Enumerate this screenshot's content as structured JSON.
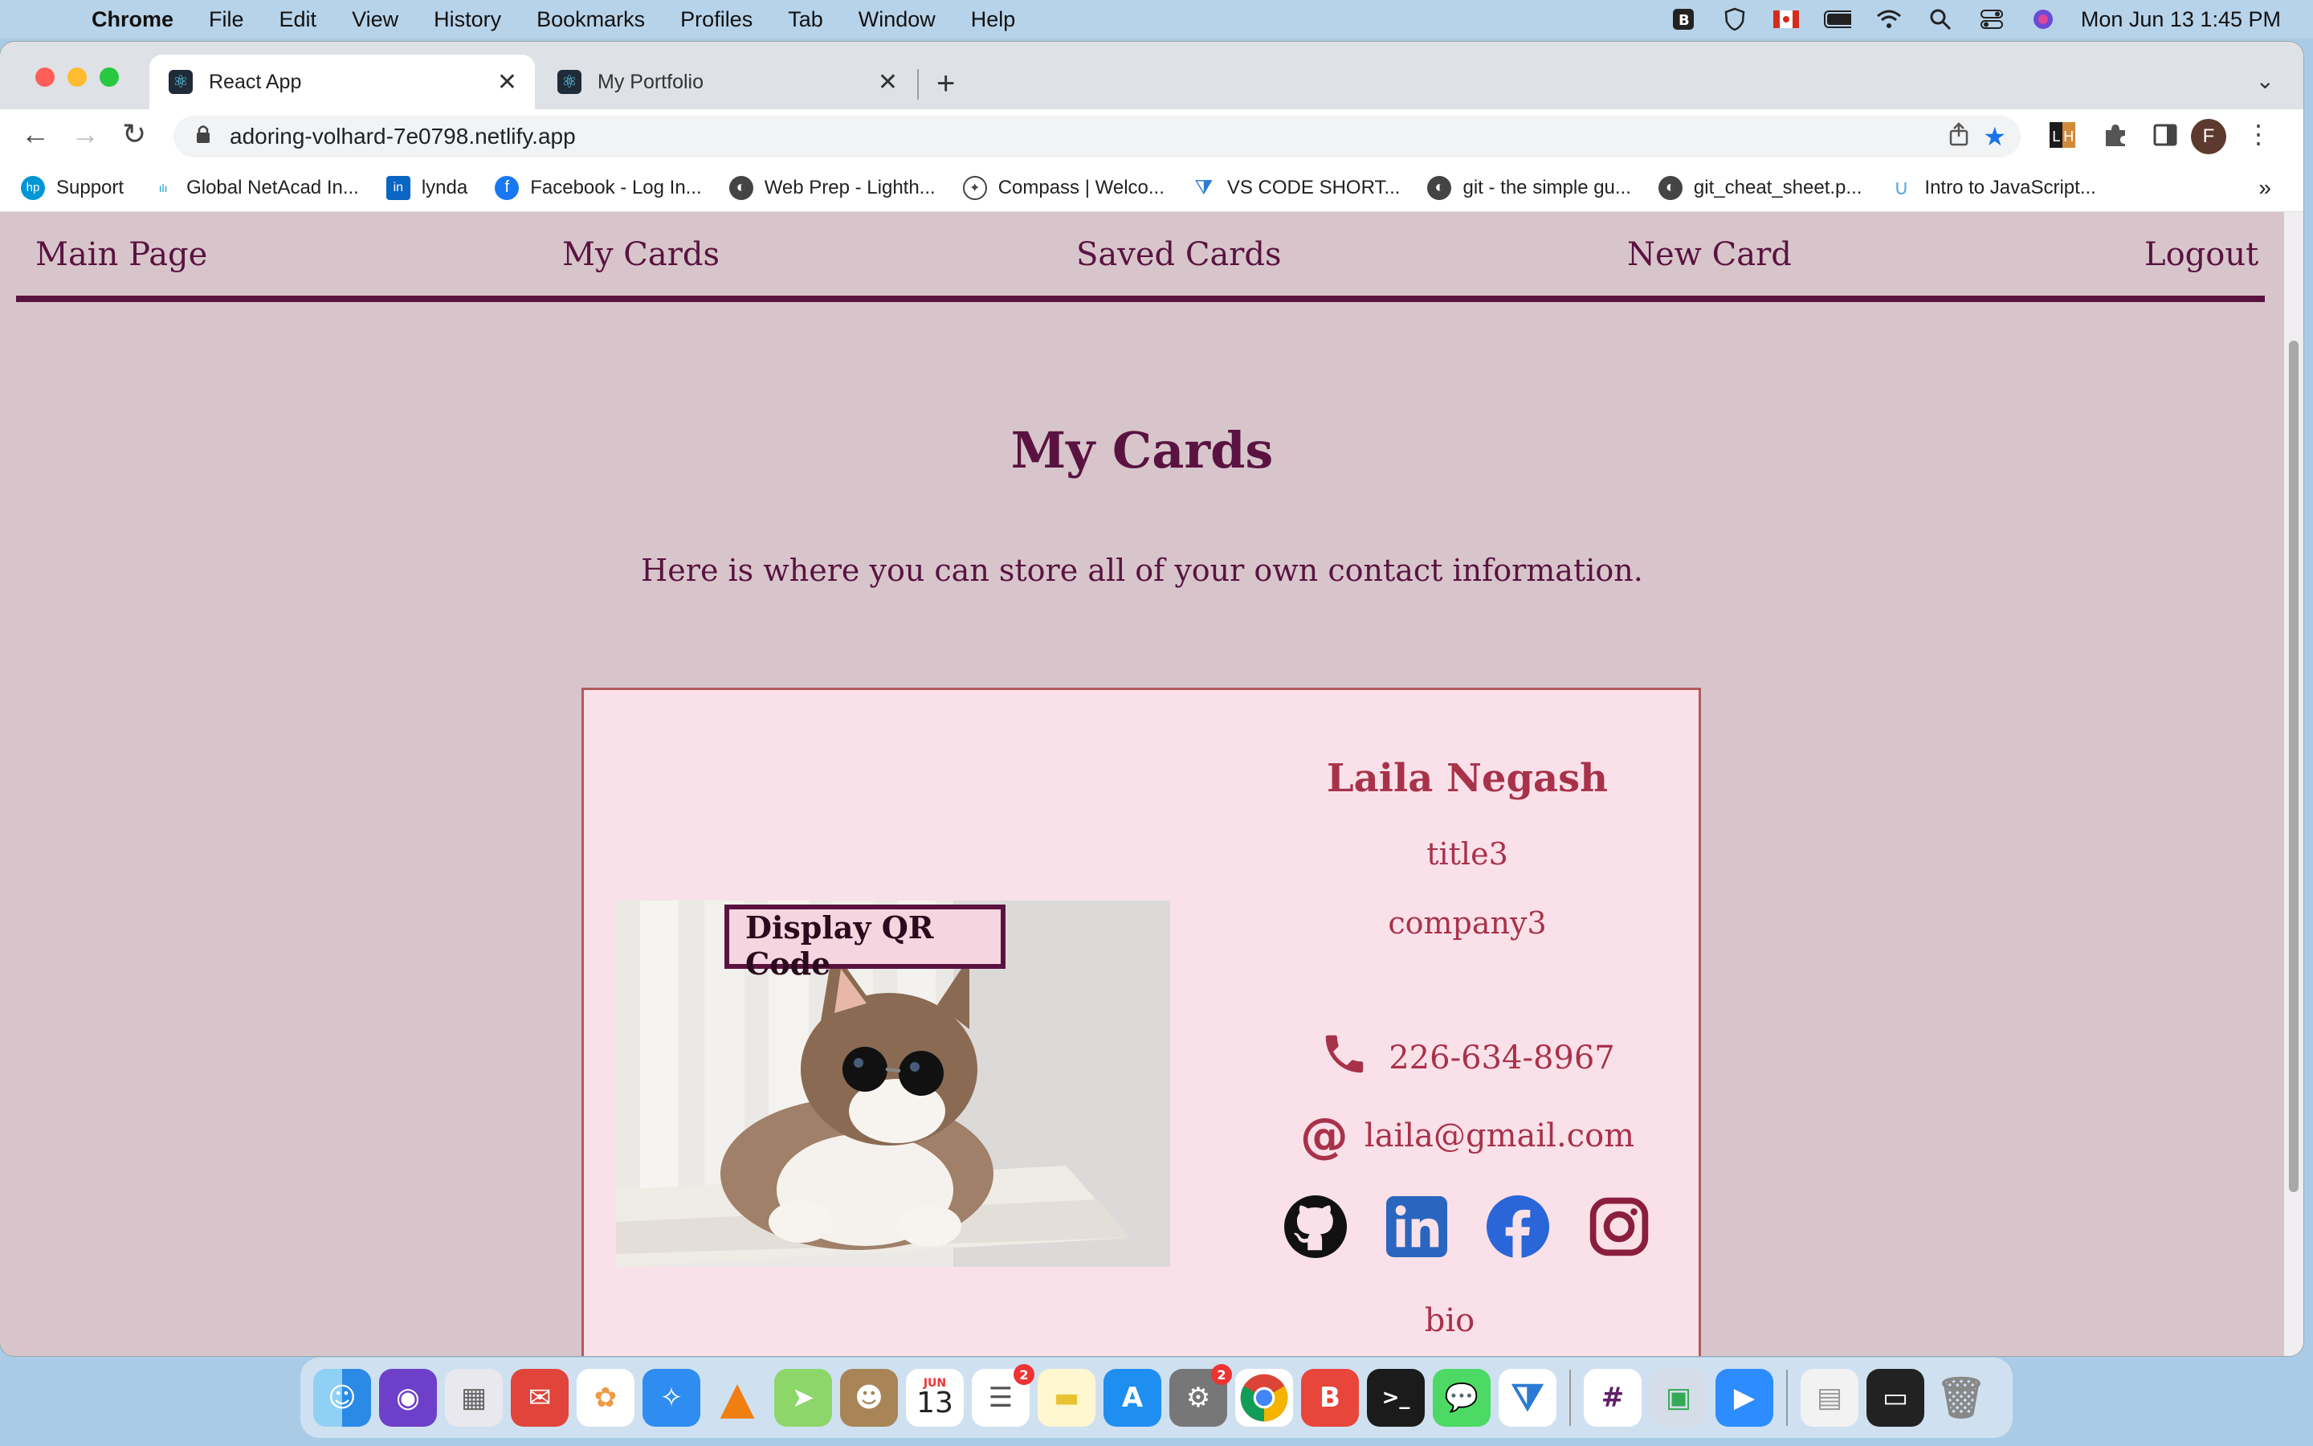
{
  "menubar": {
    "app": "Chrome",
    "items": [
      "File",
      "Edit",
      "View",
      "History",
      "Bookmarks",
      "Profiles",
      "Tab",
      "Window",
      "Help"
    ],
    "clock": "Mon Jun 13  1:45 PM"
  },
  "browser": {
    "tabs": [
      {
        "title": "React App"
      },
      {
        "title": "My Portfolio"
      }
    ],
    "url": "adoring-volhard-7e0798.netlify.app",
    "profile_initial": "F",
    "bookmarks": [
      {
        "label": "Support",
        "icon": "hp-icon",
        "color": "#0096d6"
      },
      {
        "label": "Global NetAcad In...",
        "icon": "cisco-icon",
        "color": "#1ba0d7"
      },
      {
        "label": "lynda",
        "icon": "linkedin-icon",
        "color": "#0a66c2"
      },
      {
        "label": "Facebook - Log In...",
        "icon": "facebook-icon",
        "color": "#1877f2"
      },
      {
        "label": "Web Prep - Lighth...",
        "icon": "globe-icon",
        "color": "#444444"
      },
      {
        "label": "Compass | Welco...",
        "icon": "compass-icon",
        "color": "#444444"
      },
      {
        "label": "VS CODE SHORT...",
        "icon": "vscode-icon",
        "color": "#2b7bd4"
      },
      {
        "label": "git - the simple gu...",
        "icon": "globe-icon",
        "color": "#444444"
      },
      {
        "label": "git_cheat_sheet.p...",
        "icon": "globe-icon",
        "color": "#444444"
      },
      {
        "label": "Intro to JavaScript...",
        "icon": "udemy-icon",
        "color": "#5aa9e6"
      }
    ]
  },
  "site": {
    "nav": [
      "Main Page",
      "My Cards",
      "Saved Cards",
      "New Card",
      "Logout"
    ],
    "title": "My Cards",
    "subtitle": "Here is where you can store all of your own contact information.",
    "card": {
      "name": "Laila Negash",
      "job_title": "title3",
      "company": "company3",
      "phone": "226-634-8967",
      "email": "laila@gmail.com",
      "bio": "bio",
      "qr_button": "Display QR Code",
      "photo_alt": "cat wearing sunglasses"
    },
    "colors": {
      "background": "#d7c5cb",
      "primary": "#5a1340",
      "card_bg": "#fae1e9",
      "card_text": "#a8324a"
    }
  },
  "dock": {
    "apps": [
      "Finder",
      "GitHub Desktop",
      "Launchpad",
      "Mail",
      "Photos",
      "Safari",
      "VLC",
      "Maps",
      "Contacts",
      "Calendar",
      "Reminders",
      "Notes",
      "App Store",
      "System Preferences",
      "Chrome",
      "Brave",
      "Terminal",
      "Messages",
      "VS Code",
      "Slack",
      "Preview",
      "Zoom",
      "Document",
      "Screenshot",
      "Trash"
    ],
    "calendar_month": "JUN",
    "calendar_day": "13",
    "reminders_badge": "2",
    "settings_badge": "2"
  }
}
